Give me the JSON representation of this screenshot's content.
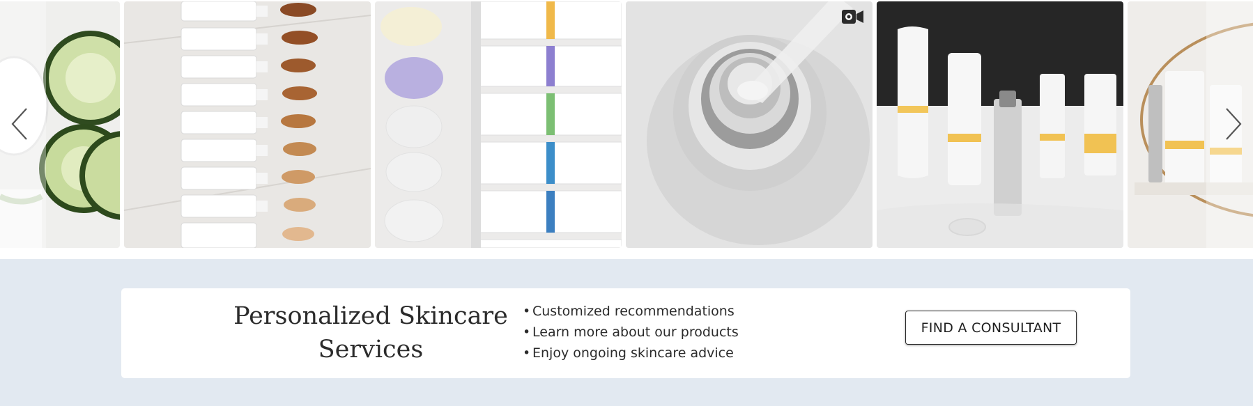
{
  "carousel": {
    "tiles": [
      {
        "icon": "cucumber-cream-image"
      },
      {
        "icon": "foundation-swatches-image"
      },
      {
        "icon": "cleanser-tubes-image"
      },
      {
        "icon": "dropper-bottle-image"
      },
      {
        "icon": "product-lineup-image"
      },
      {
        "icon": "product-tray-image"
      }
    ],
    "prev_icon": "chevron-left-icon",
    "next_icon": "chevron-right-icon",
    "video_icon": "video-camera-icon"
  },
  "promo": {
    "title": "Personalized Skincare Services",
    "benefits": [
      "Customized recommendations",
      "Learn more about our products",
      "Enjoy ongoing skincare advice"
    ],
    "bullet": "•",
    "cta_label": "FIND A CONSULTANT"
  },
  "colors": {
    "band_background": "#e2e9f1",
    "card_background": "#ffffff",
    "text": "#2b2b2b"
  }
}
